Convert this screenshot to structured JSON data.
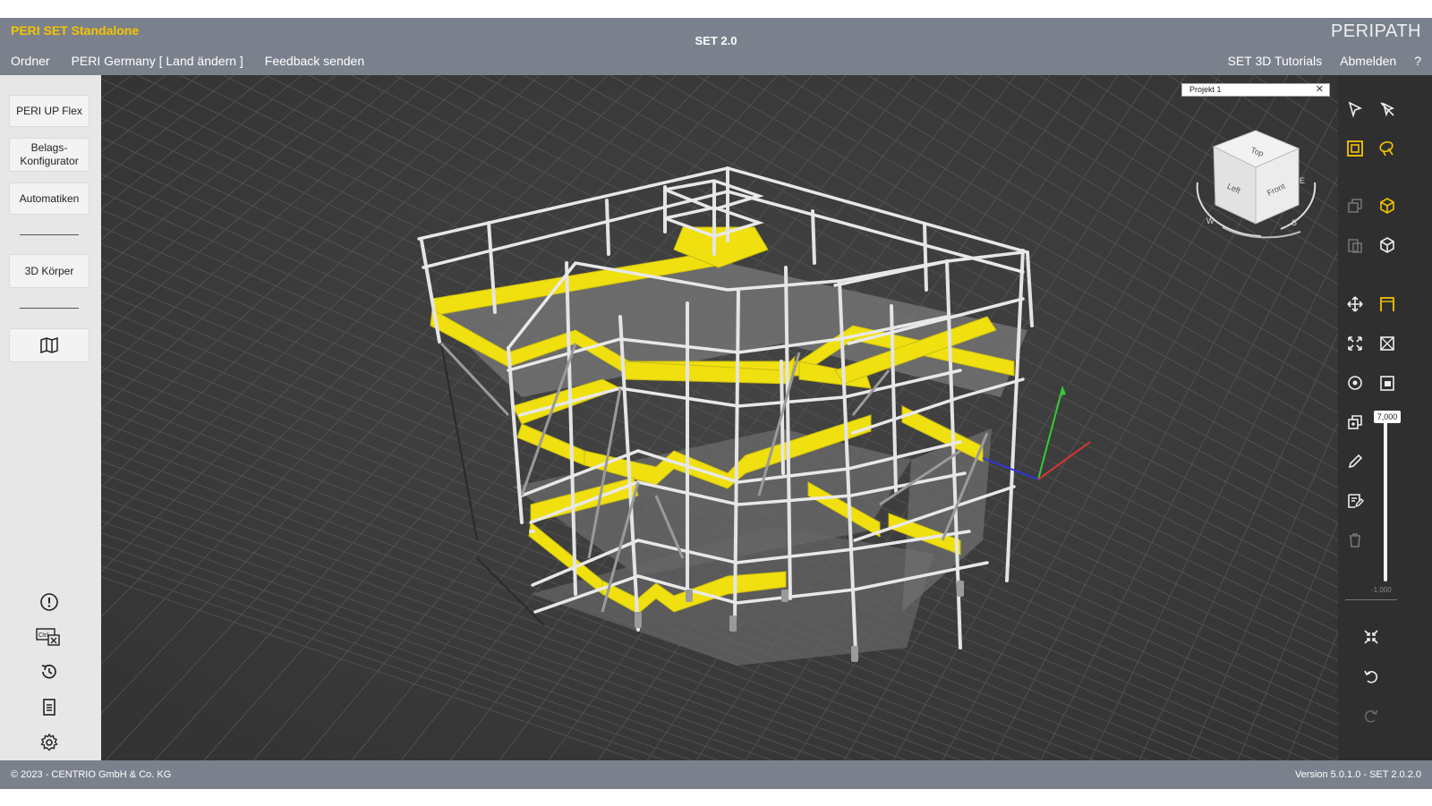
{
  "header": {
    "app_title": "PERI SET Standalone",
    "center_title": "SET 2.0",
    "brand_bold": "PERI",
    "brand_light": "PATH"
  },
  "menu": {
    "items": [
      "Ordner",
      "PERI Germany [ Land ändern ]",
      "Feedback senden"
    ],
    "right_items": [
      "SET 3D Tutorials",
      "Abmelden",
      "?"
    ]
  },
  "sidebar": {
    "buttons": [
      "PERI UP Flex",
      "Belags-\nKonfigurator",
      "Automatiken",
      "3D Körper"
    ],
    "plan_icon": "floorplan-icon",
    "bottom_icons": [
      "warning-icon",
      "keyboard-shortcut-icon",
      "history-icon",
      "document-icon",
      "gear-icon"
    ]
  },
  "viewport": {
    "project_tab": "Projekt 1",
    "view_cube": {
      "top": "Top",
      "left": "Left",
      "front": "Front",
      "compass": [
        "W",
        "S",
        "E"
      ]
    }
  },
  "toolbar": {
    "slider_value": "7,000",
    "slider_min": "-1,000",
    "accent_color": "#f5c400"
  },
  "footer": {
    "copyright": "© 2023 - CENTRIO GmbH & Co. KG",
    "version": "Version 5.0.1.0 - SET 2.0.2.0"
  },
  "colors": {
    "chrome": "#7b818c",
    "sidebar": "#e7e7e7",
    "viewport": "#3d3d3d",
    "toolbar": "#2f2f2f",
    "deck": "#f0e010"
  }
}
